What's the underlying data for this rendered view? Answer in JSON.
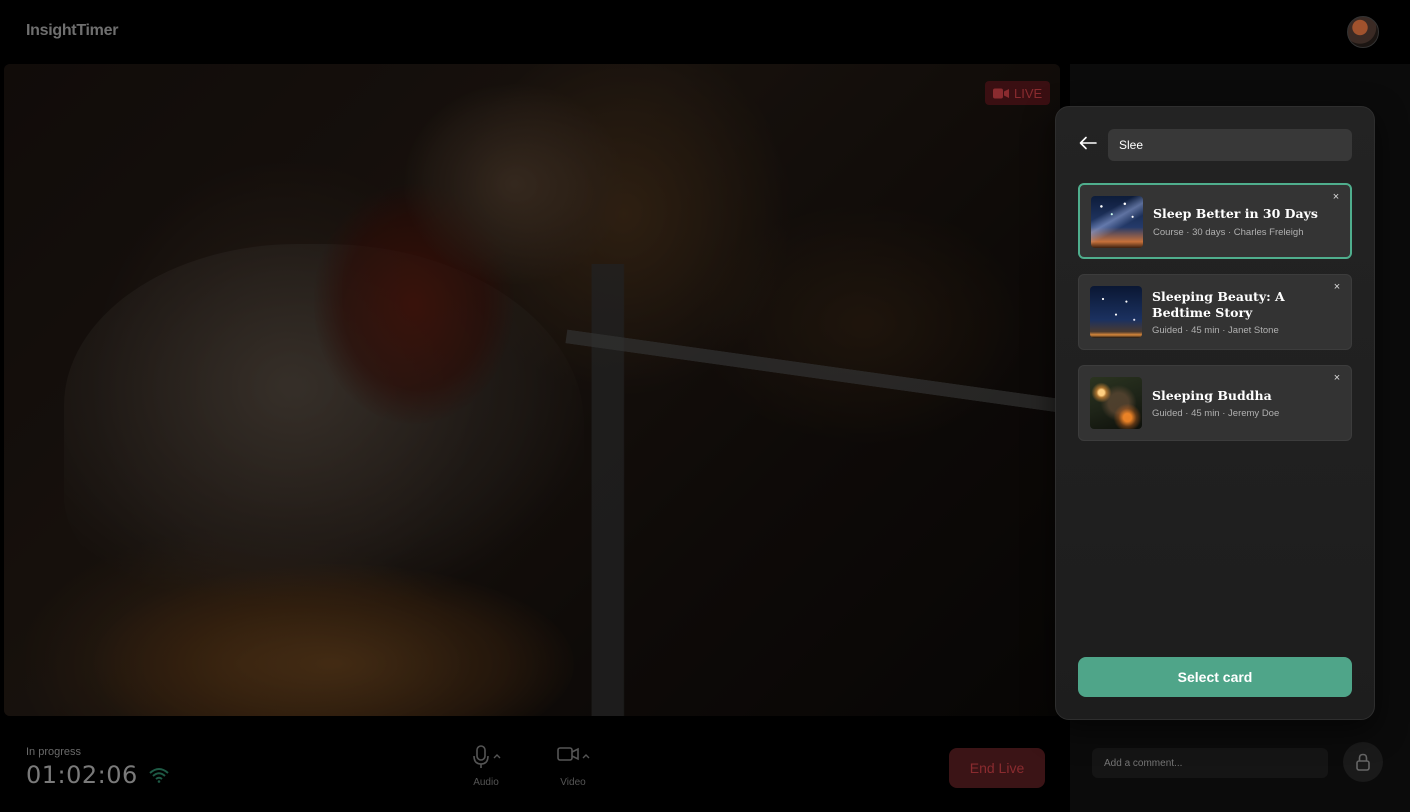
{
  "app": {
    "brand": "InsightTimer"
  },
  "video": {
    "live_label": "LIVE"
  },
  "controls": {
    "progress_label": "In progress",
    "timer": "01:02:06",
    "audio_label": "Audio",
    "video_label": "Video",
    "end_live_label": "End Live"
  },
  "side_panel": {
    "comment_placeholder": "Add a comment..."
  },
  "modal": {
    "search_value": "Slee",
    "results": [
      {
        "title": "Sleep Better in 30 Days",
        "meta": "Course · 30 days · Charles Freleigh",
        "selected": true,
        "thumbnail": "starry-sky-tree"
      },
      {
        "title": "Sleeping Beauty: A Bedtime Story",
        "meta": "Guided · 45 min  · Janet Stone",
        "selected": false,
        "thumbnail": "night-sky-horizon"
      },
      {
        "title": "Sleeping Buddha",
        "meta": "Guided · 45 min  · Jeremy Doe",
        "selected": false,
        "thumbnail": "lantern-garden"
      }
    ],
    "close_glyph": "×",
    "select_button_label": "Select card"
  },
  "colors": {
    "accent": "#4fa589",
    "selected_border": "#4fae8d",
    "live_red": "#8a2b2f",
    "modal_bg": "#222222",
    "card_bg": "#333333"
  }
}
